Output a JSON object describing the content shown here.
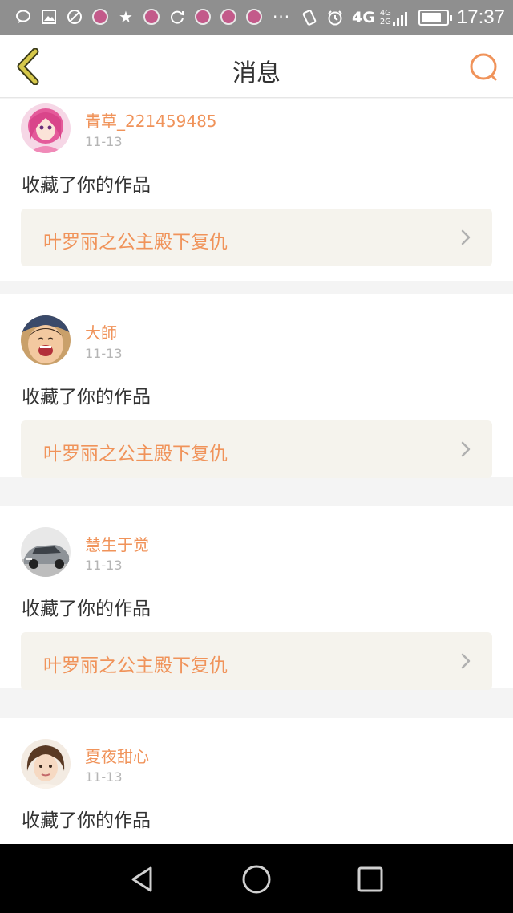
{
  "status_bar": {
    "network": "4G",
    "network_secondary": [
      "4G",
      "2G"
    ],
    "time": "17:37",
    "icons": [
      "chat-icon",
      "image-icon",
      "mute-icon",
      "lotus-app-icon",
      "star-icon",
      "lotus-app-icon",
      "sync-icon",
      "lotus-app-icon",
      "lotus-app-icon",
      "lotus-app-icon",
      "more-icon",
      "vibrate-icon",
      "alarm-icon",
      "signal-icon",
      "battery-icon"
    ],
    "battery_level": 0.8
  },
  "header": {
    "title": "消息",
    "back_icon": "chevron-left-icon",
    "search_icon": "search-icon"
  },
  "messages": [
    {
      "username": "青草_221459485",
      "date": "11-13",
      "action": "收藏了你的作品",
      "work_title": "叶罗丽之公主殿下复仇",
      "avatar": "anime-pink-hair"
    },
    {
      "username": "大師",
      "date": "11-13",
      "action": "收藏了你的作品",
      "work_title": "叶罗丽之公主殿下复仇",
      "avatar": "laughing-baby"
    },
    {
      "username": "慧生于觉",
      "date": "11-13",
      "action": "收藏了你的作品",
      "work_title": "叶罗丽之公主殿下复仇",
      "avatar": "silver-car"
    },
    {
      "username": "夏夜甜心",
      "date": "11-13",
      "action": "收藏了你的作品",
      "avatar": "portrait-girl"
    }
  ],
  "colors": {
    "accent": "#f0935a",
    "link_bg": "#f5f3ed",
    "back_icon": "#b8a832",
    "separator": "#f4f4f4"
  },
  "nav_bar": {
    "buttons": [
      "back-triangle-icon",
      "home-circle-icon",
      "recents-square-icon"
    ]
  }
}
